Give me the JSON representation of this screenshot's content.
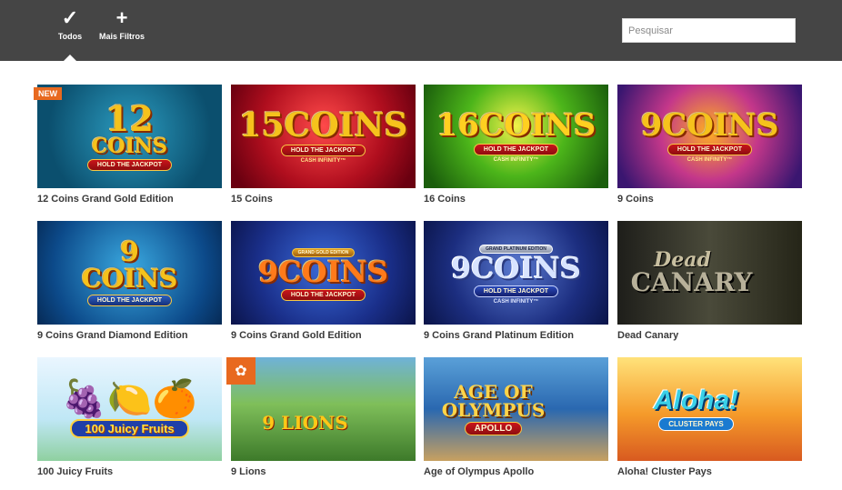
{
  "header": {
    "filters": [
      {
        "label": "Todos",
        "icon": "checkmark-icon",
        "glyph": "✓"
      },
      {
        "label": "Mais Filtros",
        "icon": "plus-icon",
        "glyph": "+"
      }
    ],
    "search": {
      "placeholder": "Pesquisar",
      "value": ""
    }
  },
  "badges": {
    "new": "NEW",
    "clover_icon": "clover-icon"
  },
  "games": [
    {
      "title": "12 Coins Grand Gold Edition",
      "logo_top": "12",
      "logo_main": "COINS",
      "tagline": "HOLD THE JACKPOT",
      "subtag": "CASH INFINITY™"
    },
    {
      "title": "15 Coins",
      "logo_top": "",
      "logo_main": "15COINS",
      "tagline": "HOLD THE JACKPOT",
      "subtag": "CASH INFINITY™"
    },
    {
      "title": "16 Coins",
      "logo_top": "",
      "logo_main": "16COINS",
      "tagline": "HOLD THE JACKPOT",
      "subtag": "CASH INFINITY™"
    },
    {
      "title": "9 Coins",
      "logo_top": "",
      "logo_main": "9COINS",
      "tagline": "HOLD THE JACKPOT",
      "subtag": "CASH INFINITY™"
    },
    {
      "title": "9 Coins Grand Diamond Edition",
      "logo_top": "9",
      "logo_main": "COINS",
      "tagline": "HOLD THE JACKPOT",
      "subtag": "CASH INFINITY™"
    },
    {
      "title": "9 Coins Grand Gold Edition",
      "logo_top": "GRAND GOLD EDITION",
      "logo_main": "9COINS",
      "tagline": "HOLD THE JACKPOT",
      "subtag": ""
    },
    {
      "title": "9 Coins Grand Platinum Edition",
      "logo_top": "GRAND PLATINUM EDITION",
      "logo_main": "9COINS",
      "tagline": "HOLD THE JACKPOT",
      "subtag": "CASH INFINITY™"
    },
    {
      "title": "Dead Canary",
      "logo_top": "Dead",
      "logo_main": "CANARY",
      "tagline": "",
      "subtag": ""
    },
    {
      "title": "100 Juicy Fruits",
      "logo_top": "",
      "logo_main": "100 Juicy Fruits",
      "tagline": "",
      "subtag": ""
    },
    {
      "title": "9 Lions",
      "logo_top": "",
      "logo_main": "9 LIONS",
      "tagline": "",
      "subtag": ""
    },
    {
      "title": "Age of Olympus Apollo",
      "logo_top": "AGE OF",
      "logo_main": "OLYMPUS",
      "tagline": "APOLLO",
      "subtag": ""
    },
    {
      "title": "Aloha! Cluster Pays",
      "logo_top": "",
      "logo_main": "Aloha!",
      "tagline": "CLUSTER PAYS",
      "subtag": ""
    }
  ],
  "colors": {
    "topbar": "#454545",
    "badge": "#e8691f",
    "title_text": "#3a3a3a"
  }
}
